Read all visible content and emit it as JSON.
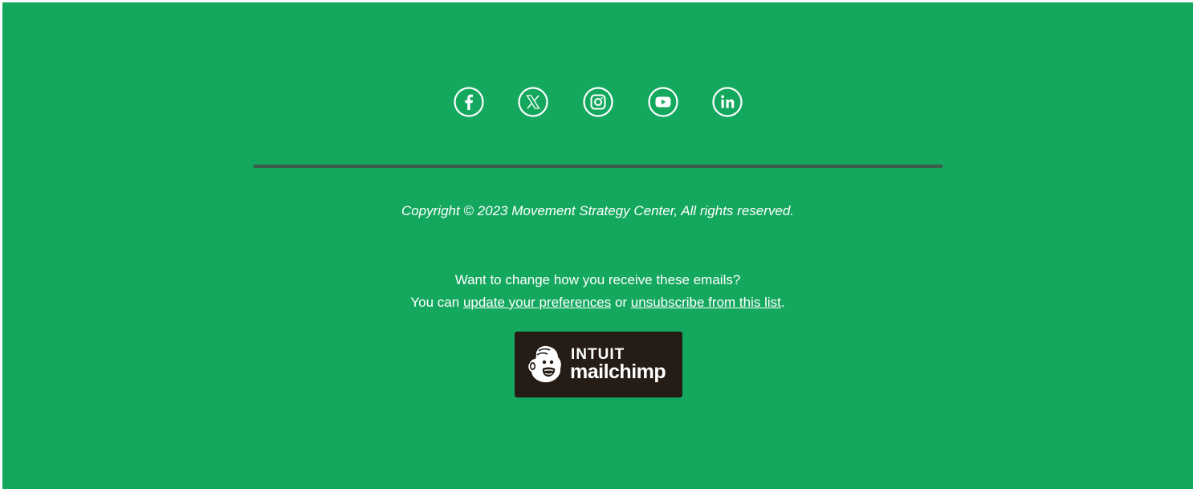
{
  "colors": {
    "background": "#14a85e",
    "divider": "#3d5a4a",
    "text": "#ffffff",
    "badge_background": "#241c15"
  },
  "social": [
    {
      "name": "facebook",
      "icon": "facebook-icon"
    },
    {
      "name": "x",
      "icon": "x-icon"
    },
    {
      "name": "instagram",
      "icon": "instagram-icon"
    },
    {
      "name": "youtube",
      "icon": "youtube-icon"
    },
    {
      "name": "linkedin",
      "icon": "linkedin-icon"
    }
  ],
  "footer": {
    "copyright": "Copyright © 2023 Movement Strategy Center, All rights reserved.",
    "prefs_question": "Want to change how you receive these emails?",
    "prefs_prefix": "You can ",
    "update_link": "update your preferences",
    "prefs_or": " or ",
    "unsubscribe_link": "unsubscribe from this list",
    "prefs_suffix": "."
  },
  "badge": {
    "top": "INTUIT",
    "bottom": "mailchimp",
    "icon": "mailchimp-freddie-icon"
  }
}
